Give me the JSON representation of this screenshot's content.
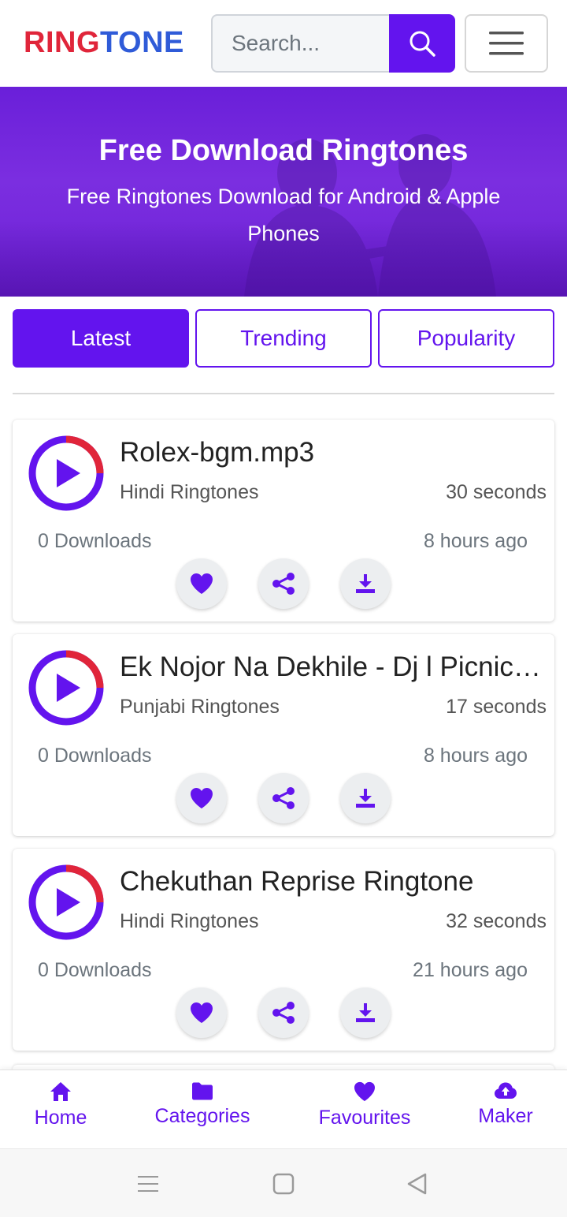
{
  "header": {
    "logo_part1": "RING",
    "logo_part2": "TONE",
    "search_placeholder": "Search...",
    "search_icon": "search-icon",
    "menu_icon": "hamburger-menu-icon"
  },
  "banner": {
    "title": "Free Download Ringtones",
    "subtitle": "Free Ringtones Download for Android & Apple Phones"
  },
  "tabs": [
    {
      "label": "Latest",
      "active": true
    },
    {
      "label": "Trending",
      "active": false
    },
    {
      "label": "Popularity",
      "active": false
    }
  ],
  "ringtones": [
    {
      "title": "Rolex-bgm.mp3",
      "category": "Hindi Ringtones",
      "duration": "30 seconds",
      "downloads": "0 Downloads",
      "time": "8 hours ago"
    },
    {
      "title": "Ek Nojor Na Dekhile - Dj l Picnic Special Song",
      "category": "Punjabi Ringtones",
      "duration": "17 seconds",
      "downloads": "0 Downloads",
      "time": "8 hours ago"
    },
    {
      "title": "Chekuthan Reprise Ringtone",
      "category": "Hindi Ringtones",
      "duration": "32 seconds",
      "downloads": "0 Downloads",
      "time": "21 hours ago"
    }
  ],
  "bottom_nav": [
    {
      "label": "Home",
      "icon": "home-icon"
    },
    {
      "label": "Categories",
      "icon": "folder-icon"
    },
    {
      "label": "Favourites",
      "icon": "heart-icon"
    },
    {
      "label": "Maker",
      "icon": "cloud-upload-icon"
    }
  ],
  "colors": {
    "accent": "#6314ee",
    "logo_red": "#e0253a",
    "logo_blue": "#2f5bd8",
    "progress_red": "#e0253a"
  }
}
